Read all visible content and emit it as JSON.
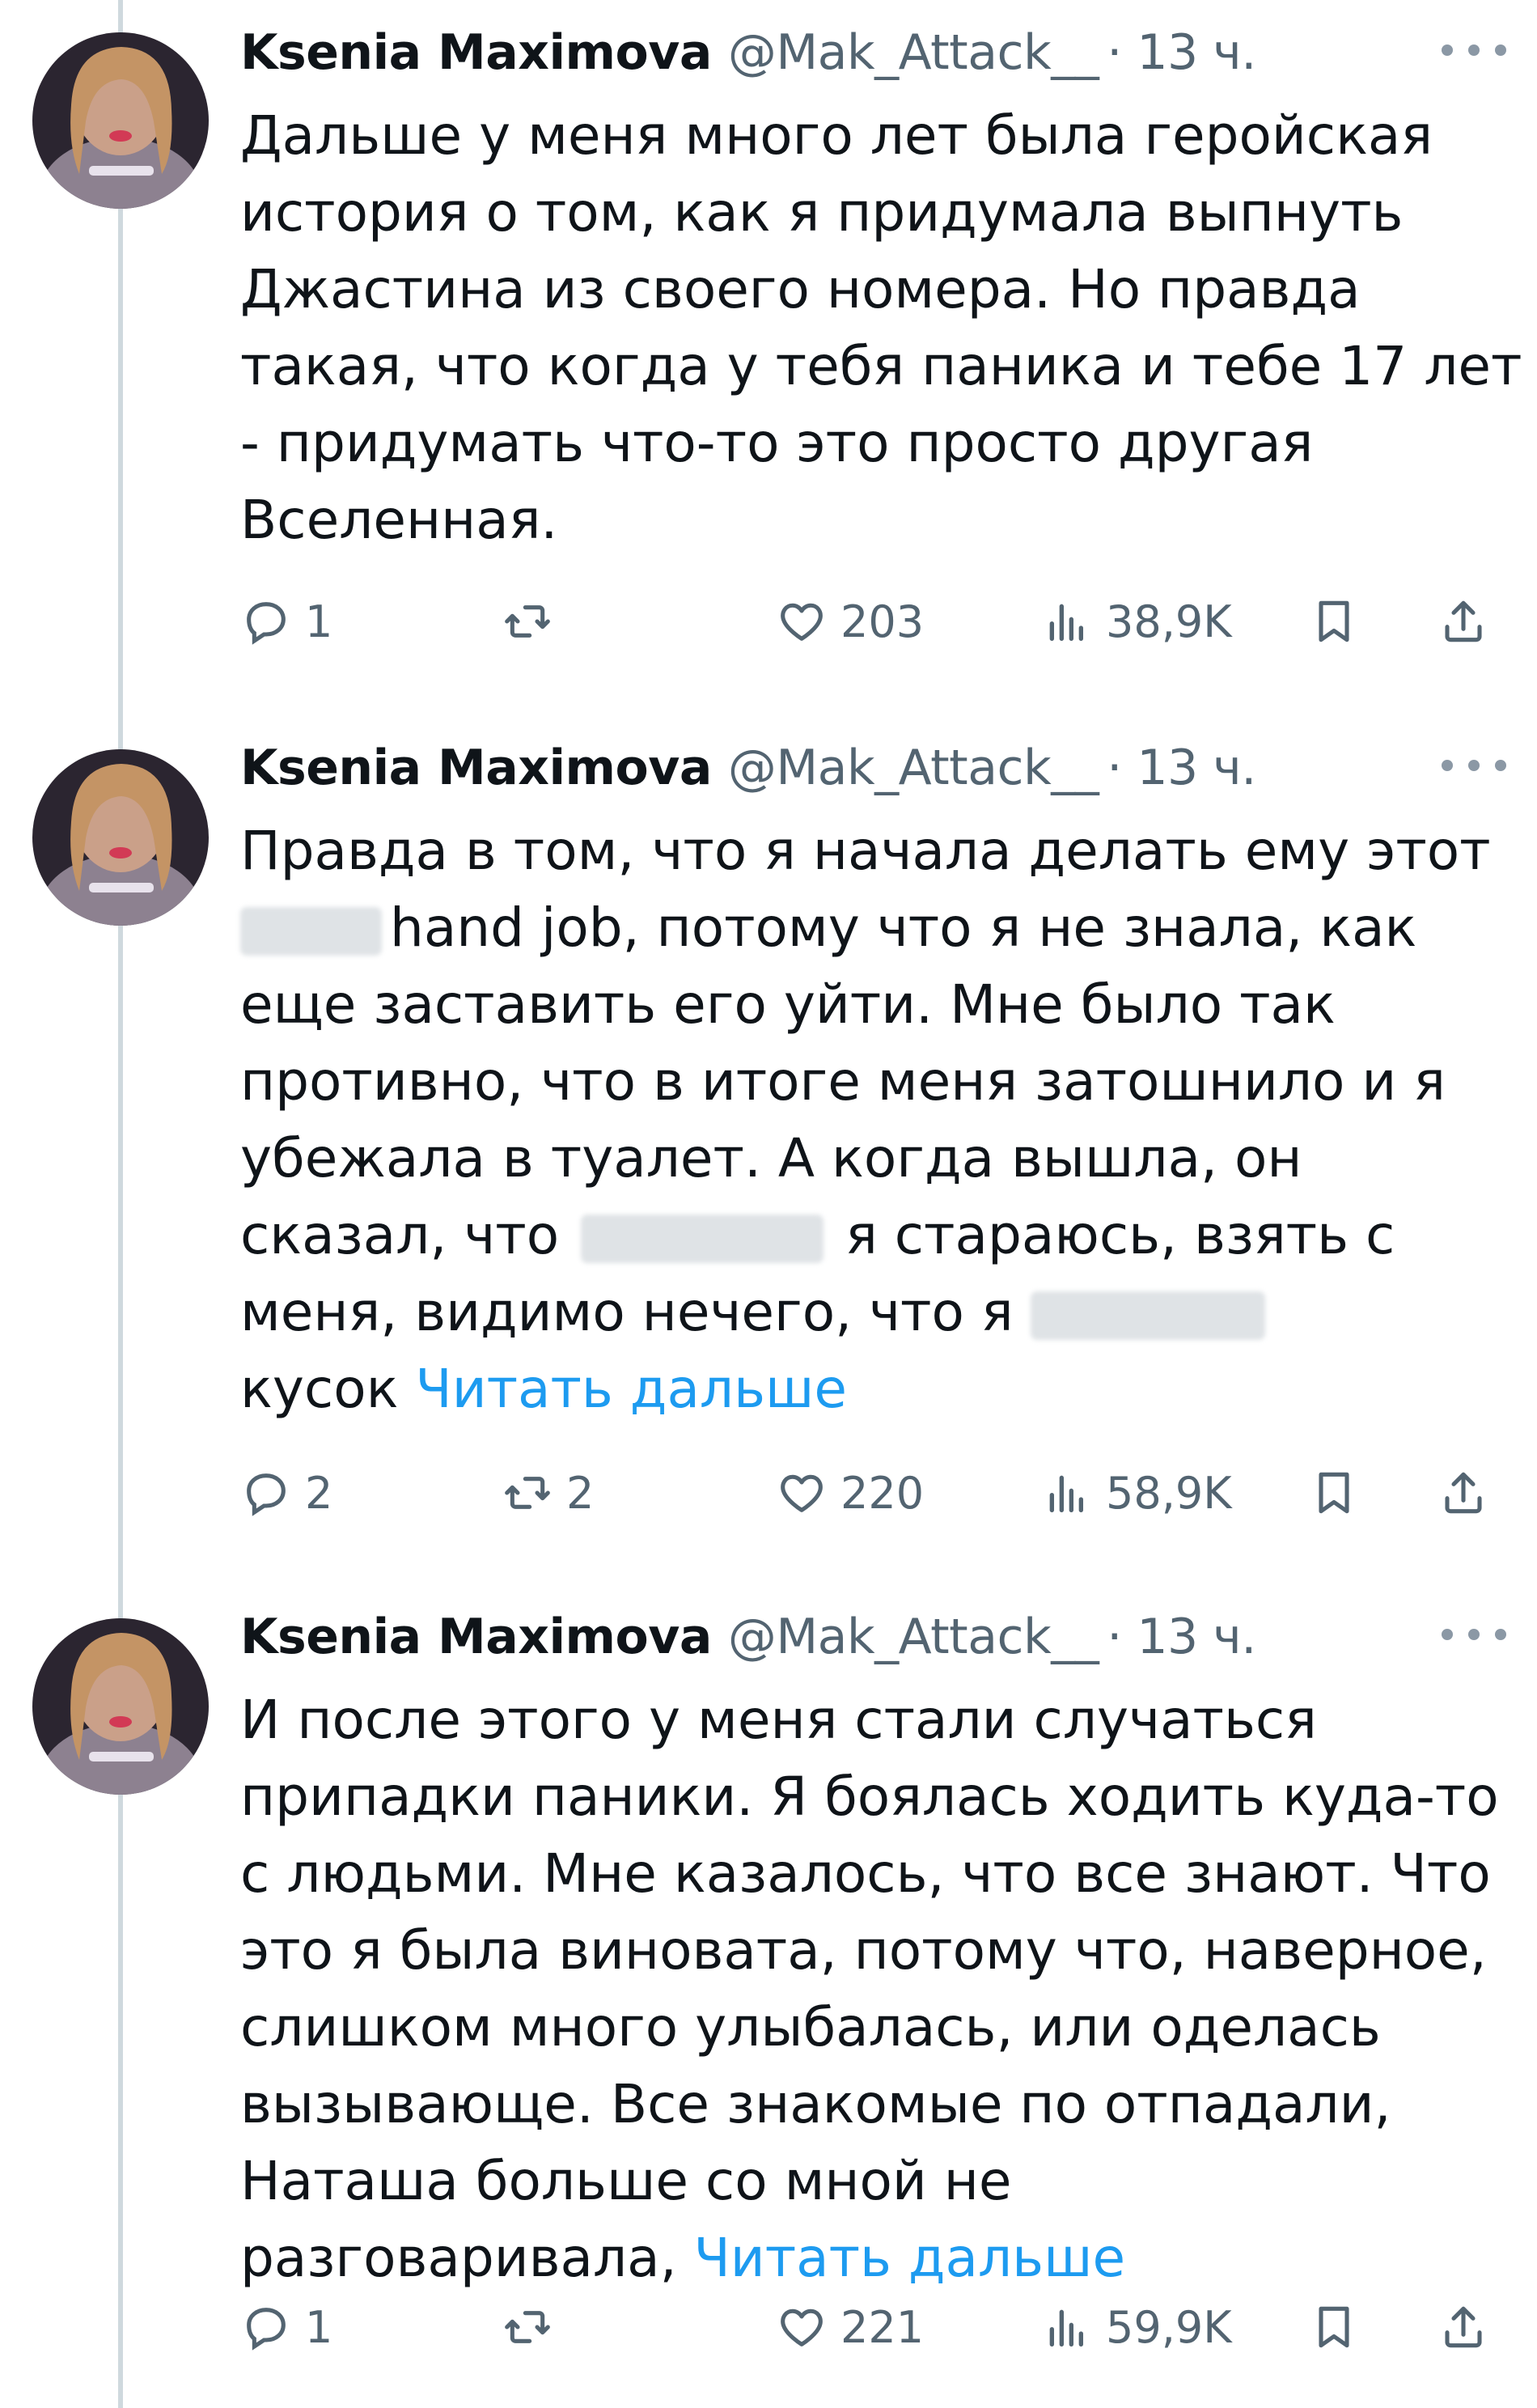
{
  "colors": {
    "text": "#0f1419",
    "secondary": "#536471",
    "link": "#1d9bf0",
    "thread_line": "#cfd9de"
  },
  "tweets": [
    {
      "author": {
        "name": "Ksenia Maximova",
        "handle": "@Mak_Attack__",
        "time": "· 13 ч."
      },
      "text_lines": [
        "Дальше у меня много лет была геройская",
        "история о том, как я придумала выпнуть",
        "Джастина из своего номера. Но правда",
        "такая, что когда у тебя паника и тебе 17 лет",
        "- придумать что-то это просто другая",
        "Вселенная."
      ],
      "stats": {
        "replies": "1",
        "retweets": "",
        "likes": "203",
        "views": "38,9K"
      }
    },
    {
      "author": {
        "name": "Ksenia Maximova",
        "handle": "@Mak_Attack__",
        "time": "· 13 ч."
      },
      "text_lines": [
        "Правда в том, что я начала делать ему этот",
        "hand job, потому что я не знала, как",
        "еще заставить его уйти. Мне было так",
        "противно, что в итоге меня затошнило и я",
        "убежала в туалет. А когда вышла, он",
        "сказал, что",
        "я стараюсь, взять с",
        "меня, видимо нечего, что я",
        "кусок"
      ],
      "read_more": "Читать дальше",
      "stats": {
        "replies": "2",
        "retweets": "2",
        "likes": "220",
        "views": "58,9K"
      }
    },
    {
      "author": {
        "name": "Ksenia Maximova",
        "handle": "@Mak_Attack__",
        "time": "· 13 ч."
      },
      "text_lines": [
        "И после этого у меня стали случаться",
        "припадки паники. Я боялась ходить куда-то",
        "с людьми. Мне казалось, что все знают. Что",
        "это я была виновата, потому что, наверное,",
        "слишком много улыбалась, или оделась",
        "вызывающе. Все знакомые по отпадали,",
        "Наташа больше со мной не",
        "разговаривала,"
      ],
      "read_more": "Читать дальше",
      "stats": {
        "replies": "1",
        "retweets": "",
        "likes": "221",
        "views": "59,9K"
      }
    }
  ],
  "icons": {
    "reply": "speech-bubble-icon",
    "retweet": "retweet-arrows-icon",
    "like": "heart-icon",
    "views": "bar-chart-icon",
    "bookmark": "bookmark-icon",
    "share": "share-upload-icon",
    "more": "more-dots-icon"
  }
}
